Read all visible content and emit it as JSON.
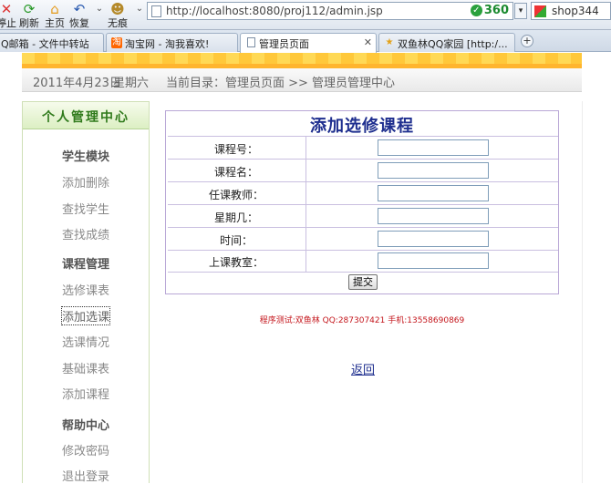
{
  "browser": {
    "toolbar": {
      "stop": "停止",
      "refresh": "刷新",
      "home": "主页",
      "restore": "恢复",
      "incognito": "无痕"
    },
    "address": {
      "url": "http://localhost:8080/proj112/admin.jsp",
      "badge": "360"
    },
    "search": {
      "text": "shop344"
    },
    "tabs": [
      {
        "label": "Q邮箱 - 文件中转站",
        "icon": "mail-icon"
      },
      {
        "label": "淘宝网 - 淘我喜欢!",
        "icon": "taobao-icon"
      },
      {
        "label": "管理员页面",
        "icon": "page-icon",
        "active": true
      },
      {
        "label": "双鱼林QQ家园 [http:/...",
        "icon": "star-icon"
      }
    ]
  },
  "page": {
    "date": "2011年4月23日",
    "weekday": "星期六",
    "breadcrumb": "当前目录：管理员页面 >> 管理员管理中心",
    "sidebar": {
      "title": "个人管理中心",
      "sections": [
        {
          "title": "学生模块",
          "items": [
            "添加删除",
            "查找学生",
            "查找成绩"
          ]
        },
        {
          "title": "课程管理",
          "items": [
            "选修课表",
            "添加选课",
            "选课情况",
            "基础课表",
            "添加课程"
          ]
        },
        {
          "title": "帮助中心",
          "items": [
            "修改密码",
            "退出登录"
          ]
        }
      ]
    },
    "form": {
      "title": "添加选修课程",
      "fields": [
        {
          "label": "课程号：",
          "value": ""
        },
        {
          "label": "课程名：",
          "value": ""
        },
        {
          "label": "任课教师：",
          "value": ""
        },
        {
          "label": "星期几：",
          "value": ""
        },
        {
          "label": "时间：",
          "value": ""
        },
        {
          "label": "上课教室：",
          "value": ""
        }
      ],
      "submit": "提交"
    },
    "footer": "程序测试:双鱼林 QQ:287307421 手机:13558690869",
    "back": "返回",
    "colors": {
      "title_blue": "#1f2f8f",
      "footer_red": "#c4161c",
      "sidebar_green": "#2f7a1b"
    }
  }
}
